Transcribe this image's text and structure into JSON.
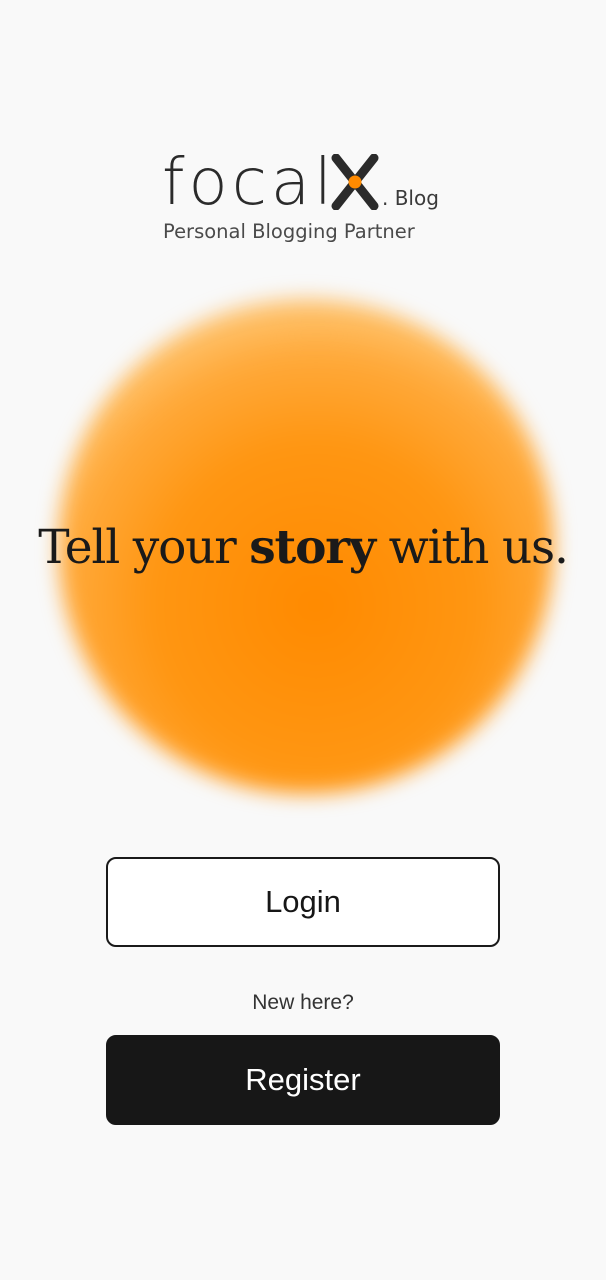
{
  "logo": {
    "wordmark": "focal",
    "x_letter": "X",
    "suffix": ". Blog",
    "tagline": "Personal Blogging Partner"
  },
  "hero": {
    "headline_pre": "Tell your ",
    "headline_bold": "story",
    "headline_post": " with us."
  },
  "auth": {
    "login_label": "Login",
    "new_here_text": "New here?",
    "register_label": "Register"
  },
  "colors": {
    "accent": "#ff8a00",
    "dark_button": "#171717",
    "background": "#f9f9f9"
  }
}
